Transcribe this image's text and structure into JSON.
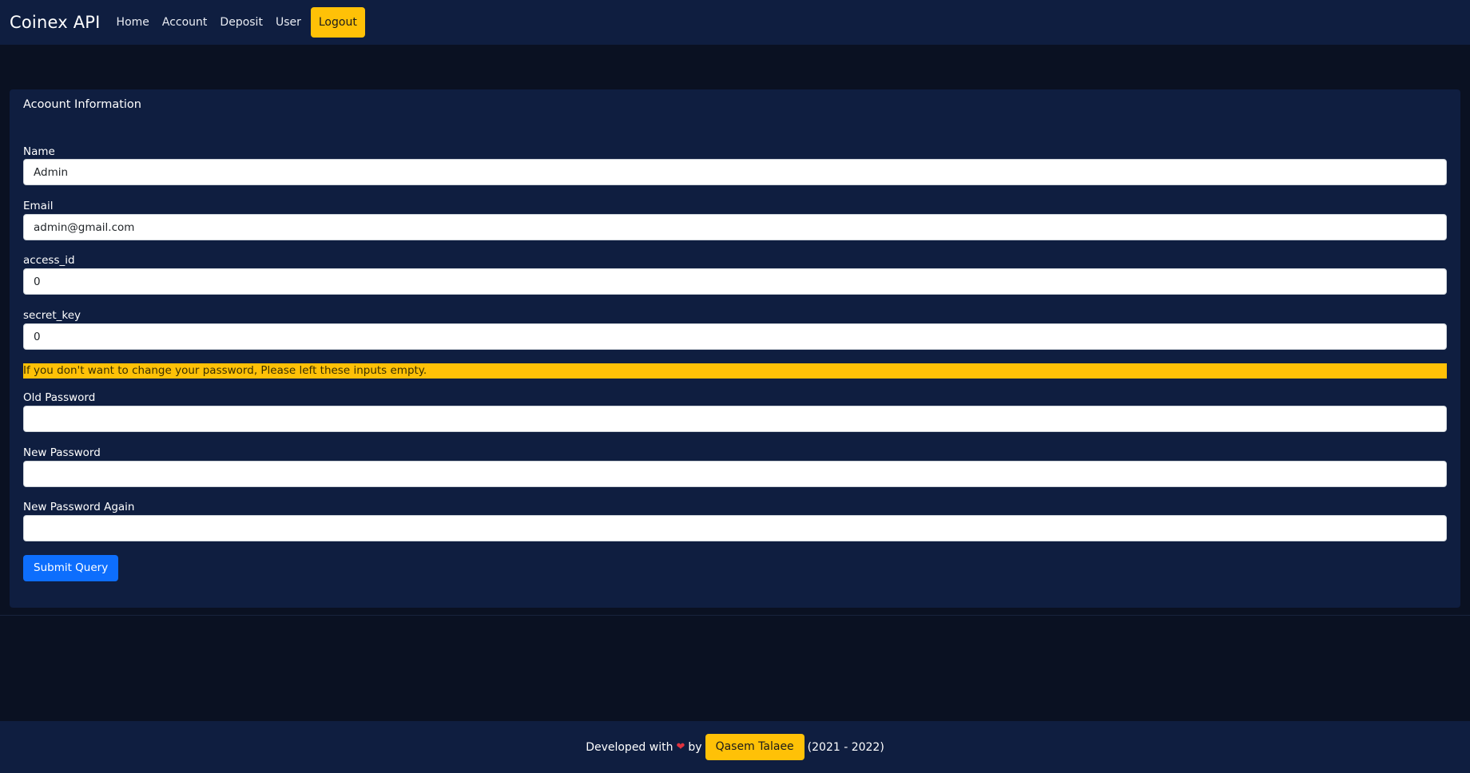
{
  "navbar": {
    "brand": "Coinex API",
    "links": [
      "Home",
      "Account",
      "Deposit",
      "User"
    ],
    "logout_label": "Logout"
  },
  "card": {
    "title": "Acoount Information",
    "fields": [
      {
        "label": "Name",
        "value": "Admin"
      },
      {
        "label": "Email",
        "value": "admin@gmail.com"
      },
      {
        "label": "access_id",
        "value": "0"
      },
      {
        "label": "secret_key",
        "value": "0"
      }
    ],
    "notice": "If you don't want to change your password, Please left these inputs empty.",
    "password_fields": [
      {
        "label": "Old Password",
        "value": ""
      },
      {
        "label": "New Password",
        "value": ""
      },
      {
        "label": "New Password Again",
        "value": ""
      }
    ],
    "submit_label": "Submit Query"
  },
  "footer": {
    "prefix": "Developed with",
    "heart_icon": "heart-icon",
    "by": "by",
    "author": "Qasem Talaee",
    "years": "(2021 - 2022)"
  },
  "colors": {
    "page_bg": "#0a1122",
    "panel_bg": "#0f1e40",
    "accent_yellow": "#ffc107",
    "primary_blue": "#0d6efd",
    "heart_red": "#e0333f"
  }
}
